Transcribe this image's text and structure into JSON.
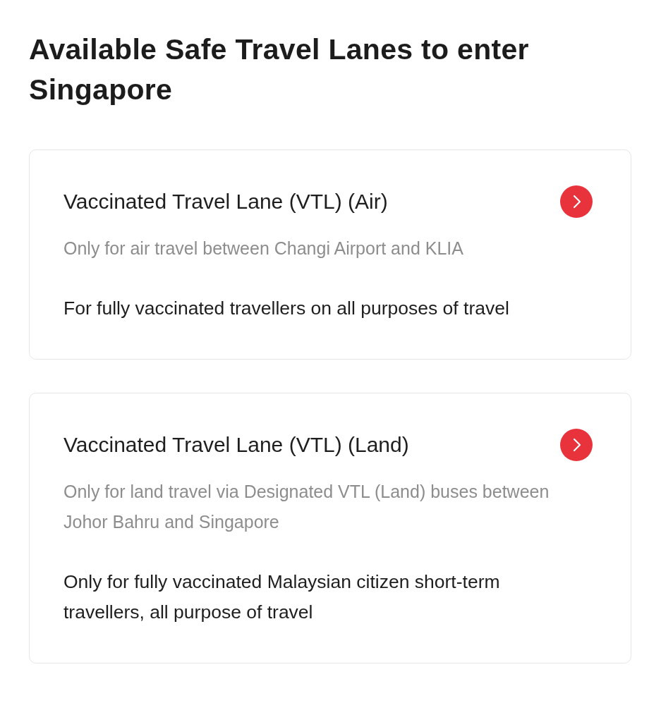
{
  "heading": "Available Safe Travel Lanes to enter Singapore",
  "lanes": [
    {
      "title": "Vaccinated Travel Lane (VTL) (Air)",
      "subtitle": "Only for air travel between Changi Airport and KLIA",
      "description": "For fully vaccinated travellers on all purposes of travel"
    },
    {
      "title": "Vaccinated Travel Lane (VTL) (Land)",
      "subtitle": "Only for land travel via Designated VTL (Land) buses between Johor Bahru and Singapore",
      "description": "Only for fully vaccinated Malaysian citizen short-term travellers, all purpose of travel"
    }
  ]
}
